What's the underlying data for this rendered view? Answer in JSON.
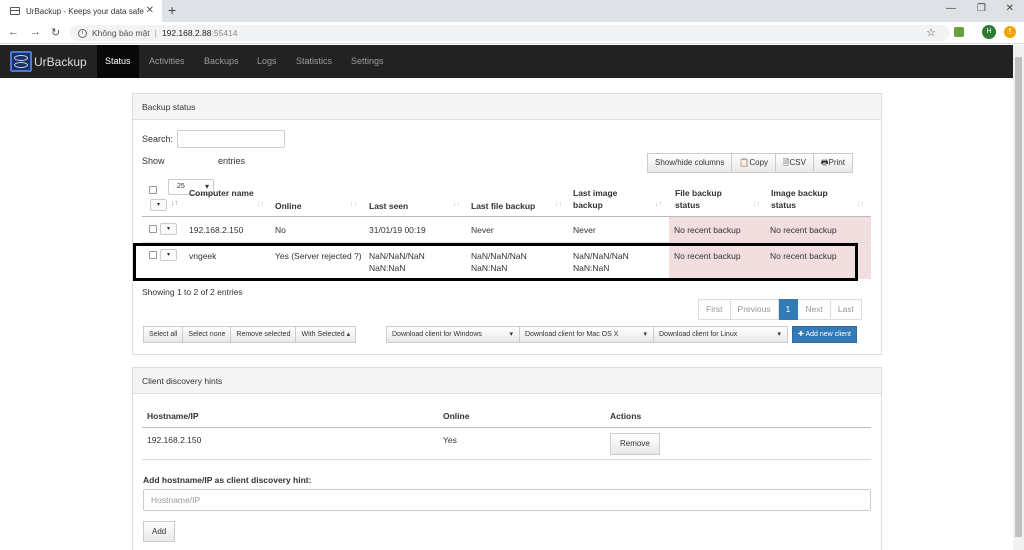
{
  "browser": {
    "tab_title": "UrBackup - Keeps your data safe",
    "security_label": "Không bảo mật",
    "url_host": "192.168.2.88",
    "url_port": ":55414",
    "avatar_initial": "H",
    "warning_mark": "!"
  },
  "nav": {
    "brand": "UrBackup",
    "items": [
      {
        "label": "Status"
      },
      {
        "label": "Activities"
      },
      {
        "label": "Backups"
      },
      {
        "label": "Logs"
      },
      {
        "label": "Statistics"
      },
      {
        "label": "Settings"
      }
    ]
  },
  "backup_status": {
    "title": "Backup status",
    "search_label": "Search:",
    "show_label": "Show",
    "show_value": "25",
    "entries_label": "entries",
    "tools": [
      "Show/hide columns",
      "Copy",
      "CSV",
      "Print"
    ],
    "columns": [
      "Computer name",
      "Online",
      "Last seen",
      "Last file backup",
      "Last image backup",
      "File backup status",
      "Image backup status"
    ],
    "rows": [
      {
        "name": "192.168.2.150",
        "online": "No",
        "last_seen": "31/01/19 00:19",
        "last_file": "Never",
        "last_image": "Never",
        "file_status": "No recent backup",
        "image_status": "No recent backup"
      },
      {
        "name": "vngeek",
        "online": "Yes (Server rejected ?)",
        "last_seen": "NaN/NaN/NaN NaN:NaN",
        "last_file": "NaN/NaN/NaN NaN:NaN",
        "last_image": "NaN/NaN/NaN NaN:NaN",
        "file_status": "No recent backup",
        "image_status": "No recent backup"
      }
    ],
    "info": "Showing 1 to 2 of 2 entries",
    "pagination": [
      "First",
      "Previous",
      "1",
      "Next",
      "Last"
    ],
    "actions": {
      "select_all": "Select all",
      "select_none": "Select none",
      "remove_selected": "Remove selected",
      "with_selected": "With Selected",
      "dl_windows": "Download client for Windows",
      "dl_mac": "Download client for Mac OS X",
      "dl_linux": "Download client for Linux",
      "add_client": "Add new client"
    }
  },
  "discovery": {
    "title": "Client discovery hints",
    "columns": [
      "Hostname/IP",
      "Online",
      "Actions"
    ],
    "rows": [
      {
        "host": "192.168.2.150",
        "online": "Yes",
        "action": "Remove"
      }
    ],
    "add_label": "Add hostname/IP as client discovery hint:",
    "placeholder": "Hostname/IP",
    "add_button": "Add"
  }
}
